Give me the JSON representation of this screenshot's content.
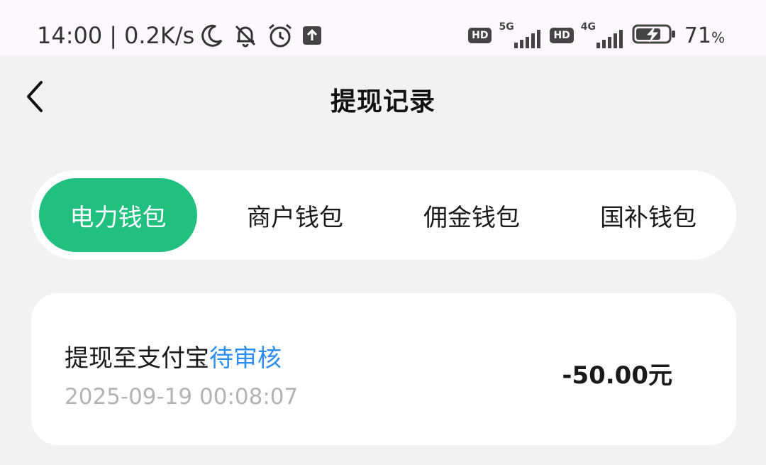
{
  "status_bar": {
    "time": "14:00",
    "separator": "|",
    "speed": "0.2K/s",
    "network_1": "5G",
    "network_2": "4G",
    "hd_label": "HD",
    "battery_value": "71",
    "battery_unit": "%",
    "icons": [
      "moon-icon",
      "bell-off-icon",
      "alarm-icon",
      "upload-icon",
      "signal-icon",
      "battery-charging-icon"
    ]
  },
  "nav": {
    "title": "提现记录"
  },
  "tabs": [
    {
      "label": "电力钱包",
      "active": true
    },
    {
      "label": "商户钱包",
      "active": false
    },
    {
      "label": "佣金钱包",
      "active": false
    },
    {
      "label": "国补钱包",
      "active": false
    }
  ],
  "records": [
    {
      "title": "提现至支付宝",
      "status": "待审核",
      "time": "2025-09-19 00:08:07",
      "amount": "-50.00元"
    }
  ],
  "colors": {
    "accent": "#21c080",
    "status_pending": "#2d8ef0",
    "background": "#f2f2f2"
  }
}
